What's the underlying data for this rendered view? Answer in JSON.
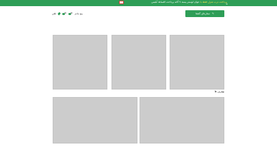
{
  "promo_bar": {
    "lead": "پرداخت درب منزل",
    "highlight": "فقط با",
    "rest": "جوان لوستر پسند ۷ گانه پرداخت اقساط آبلیس",
    "close_label": "×"
  },
  "header": {
    "cta_label": "ستاره‌ای گشتا",
    "tool_labels": [
      "تلفن",
      "پیچ مانم"
    ]
  },
  "section": {
    "title": "بهترین ها"
  },
  "colors": {
    "brand": "#2e9e57",
    "placeholder": "#cccccc"
  }
}
